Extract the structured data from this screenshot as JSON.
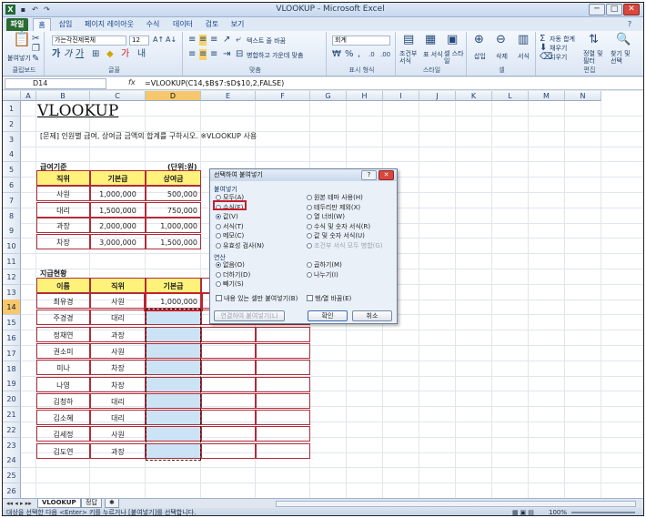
{
  "title": "VLOOKUP - Microsoft Excel",
  "window": {
    "minimize": "─",
    "maximize": "□",
    "close": "✕"
  },
  "tabs": [
    "파일",
    "홈",
    "삽입",
    "페이지 레이아웃",
    "수식",
    "데이터",
    "검토",
    "보기"
  ],
  "ribbon": {
    "clipboard": {
      "paste": "붙여넣기",
      "label": "클립보드"
    },
    "font": {
      "name": "가는각진제목체",
      "size": "12",
      "label": "글꼴"
    },
    "align": {
      "wrap": "텍스트 줄 바꿈",
      "merge": "병합하고 가운데 맞춤",
      "label": "맞춤"
    },
    "number": {
      "format": "회계",
      "label": "표시 형식"
    },
    "styles": {
      "cond": "조건부 서식",
      "table": "표 서식",
      "cell": "셀 스타일",
      "label": "스타일"
    },
    "cells": {
      "insert": "삽입",
      "delete": "삭제",
      "format": "서식",
      "label": "셀"
    },
    "editing": {
      "autosum": "자동 합계",
      "fill": "채우기",
      "clear": "지우기",
      "sort": "정렬 및 필터",
      "find": "찾기 및 선택",
      "label": "편집"
    }
  },
  "name_box": "D14",
  "fx": "fx",
  "formula": "=VLOOKUP(C14,$B$7:$D$10,2,FALSE)",
  "columns": [
    "A",
    "B",
    "C",
    "D",
    "E",
    "F",
    "G",
    "H",
    "I",
    "J",
    "K",
    "L",
    "M",
    "N"
  ],
  "rows": [
    "1",
    "2",
    "3",
    "4",
    "5",
    "6",
    "7",
    "8",
    "9",
    "10",
    "11",
    "12",
    "13",
    "14",
    "15",
    "16",
    "17",
    "18",
    "19",
    "20",
    "21",
    "22",
    "23",
    "24",
    "25",
    "26"
  ],
  "sheet": {
    "title": "VLOOKUP",
    "problem": "[문제] 인원별 급여, 상여금 금액의 합계를 구하시오. ※VLOOKUP 사용",
    "table1_title": "급여기준",
    "unit": "(단위:원)",
    "table1_headers": [
      "직위",
      "기본급",
      "상여금"
    ],
    "table1_rows": [
      [
        "사원",
        "1,000,000",
        "500,000"
      ],
      [
        "대리",
        "1,500,000",
        "750,000"
      ],
      [
        "과장",
        "2,000,000",
        "1,000,000"
      ],
      [
        "차장",
        "3,000,000",
        "1,500,000"
      ]
    ],
    "table2_title": "지급현황",
    "table2_headers": [
      "이름",
      "직위",
      "기본급"
    ],
    "table2_rows": [
      [
        "최유경",
        "사원",
        "1,000,000"
      ],
      [
        "주경경",
        "대리",
        ""
      ],
      [
        "정채연",
        "과장",
        ""
      ],
      [
        "권소미",
        "사원",
        ""
      ],
      [
        "미나",
        "차장",
        ""
      ],
      [
        "나영",
        "차장",
        ""
      ],
      [
        "김청하",
        "대리",
        ""
      ],
      [
        "김소혜",
        "대리",
        ""
      ],
      [
        "김세정",
        "사원",
        ""
      ],
      [
        "김도연",
        "과장",
        ""
      ]
    ]
  },
  "dialog": {
    "title": "선택하여 붙여넣기",
    "help": "?",
    "close": "✕",
    "paste_section": "붙여넣기",
    "paste_left": [
      "모두(A)",
      "수식(F)",
      "값(V)",
      "서식(T)",
      "메모(C)",
      "유효성 검사(N)"
    ],
    "paste_right": [
      "원본 테마 사용(H)",
      "테두리만 제외(X)",
      "열 너비(W)",
      "수식 및 숫자 서식(R)",
      "값 및 숫자 서식(U)",
      "조건부 서식 모두 병합(G)"
    ],
    "op_section": "연산",
    "op_left": [
      "없음(O)",
      "더하기(D)",
      "빼기(S)"
    ],
    "op_right": [
      "곱하기(M)",
      "나누기(I)"
    ],
    "skip_blanks": "내용 있는 셀만 붙여넣기(B)",
    "transpose": "행/열 바꿈(E)",
    "paste_link": "연결하여 붙여넣기(L)",
    "ok": "확인",
    "cancel": "취소"
  },
  "sheet_tabs": [
    "VLOOKUP",
    "정답"
  ],
  "sheet_nav": "◂◂ ◂ ▸ ▸▸",
  "status": "대상을 선택한 다음 <Enter> 키를 누르거나 [붙여넣기]를 선택합니다.",
  "zoom": "100%",
  "colors": {
    "highlight_red": "#c81e2b",
    "table_border": "#b02c3a",
    "header_yellow": "#fff27a",
    "cell_blue": "#cbe3f5"
  }
}
